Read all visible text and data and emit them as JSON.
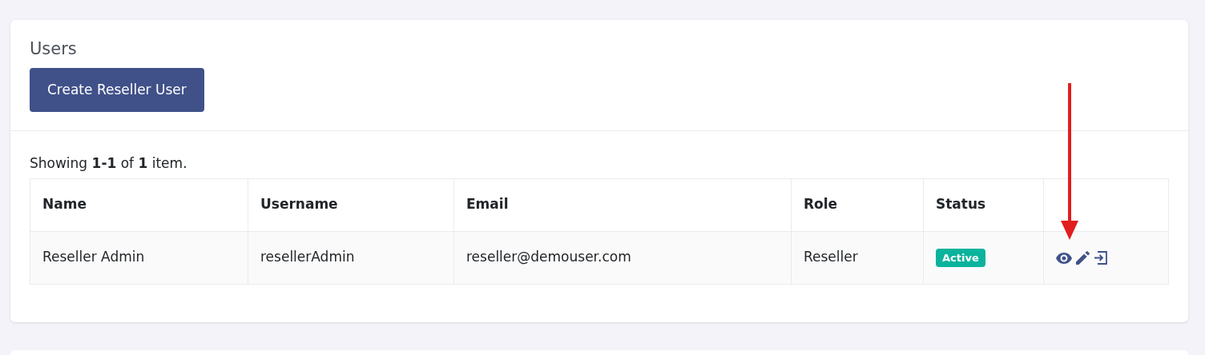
{
  "card": {
    "title": "Users",
    "create_button": "Create Reseller User"
  },
  "summary": "Showing **1-1** of **1** item.",
  "table": {
    "columns": [
      "Name",
      "Username",
      "Email",
      "Role",
      "Status"
    ],
    "rows": [
      {
        "cells": [
          "Reseller Admin",
          "resellerAdmin",
          "reseller@demouser.com",
          "Reseller"
        ],
        "status": {
          "label": "Active",
          "kind": "success"
        },
        "actions": [
          {
            "kind": "view"
          },
          {
            "kind": "edit"
          },
          {
            "kind": "login"
          }
        ]
      }
    ]
  },
  "annotation": {
    "kind": "arrow"
  }
}
